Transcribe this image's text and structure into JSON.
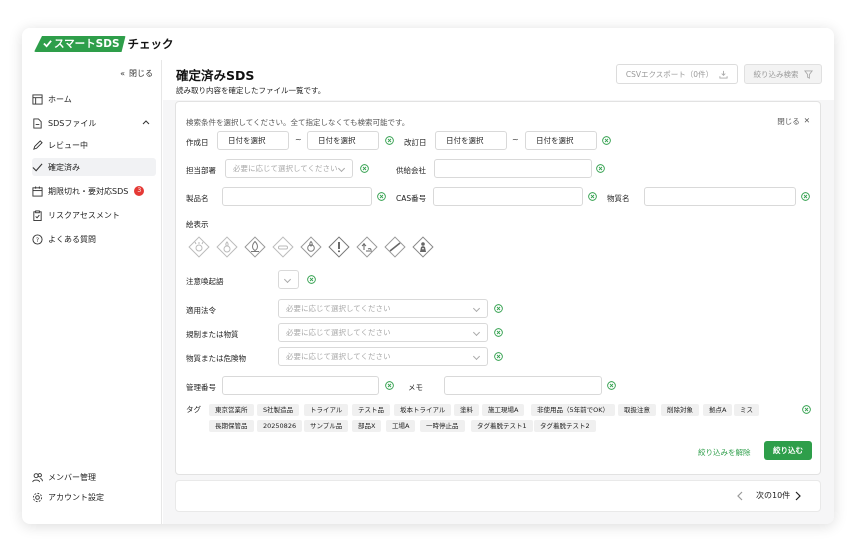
{
  "app": {
    "logo_main": "スマートSDS",
    "logo_sub": "チェック",
    "brand_color": "#2e9e4a"
  },
  "sidebar": {
    "collapse_label": "閉じる",
    "home": "ホーム",
    "sds_files": "SDSファイル",
    "review": "レビュー中",
    "confirmed": "確定済み",
    "expired": "期限切れ・要対応SDS",
    "expired_count": "3",
    "risk": "リスクアセスメント",
    "faq": "よくある質問",
    "members": "メンバー管理",
    "account": "アカウント設定"
  },
  "header": {
    "title": "確定済みSDS",
    "subtitle": "読み取り内容を確定したファイル一覧です。",
    "csv_button": "CSVエクスポート（0件）",
    "filter_button": "絞り込み検索"
  },
  "filter": {
    "hint": "検索条件を選択してください。全て指定しなくても検索可能です。",
    "close": "閉じる",
    "created_label": "作成日",
    "revised_label": "改訂日",
    "date_placeholder": "日付を選択",
    "dept_label": "担当部署",
    "dept_placeholder": "必要に応じて選択してください",
    "supplier_label": "供給会社",
    "product_label": "製品名",
    "cas_label": "CAS番号",
    "substance_label": "物質名",
    "pictogram_label": "絵表示",
    "signal_label": "注意喚起語",
    "law_label": "適用法令",
    "regulated_label": "規制または物質",
    "hazard_label": "物質または危険物",
    "select_placeholder": "必要に応じて選択してください",
    "mgmt_label": "管理番号",
    "memo_label": "メモ",
    "tag_label": "タグ",
    "tags_row1": [
      "東京営業所",
      "S社製造品",
      "トライアル",
      "テスト品",
      "坂本トライアル",
      "塗料",
      "施工現場A",
      "非使用品（5年前でOK）",
      "取扱注意",
      "削除対象",
      "拠点A",
      "ミス"
    ],
    "tags_row2": [
      "長期保管品",
      "20250826",
      "サンプル品",
      "部品X",
      "工場A",
      "一時停止品",
      "タグ着脱テスト1",
      "タグ着脱テスト2"
    ],
    "clear_link": "絞り込みを解除",
    "apply_button": "絞り込む"
  },
  "pager": {
    "next": "次の10件"
  }
}
